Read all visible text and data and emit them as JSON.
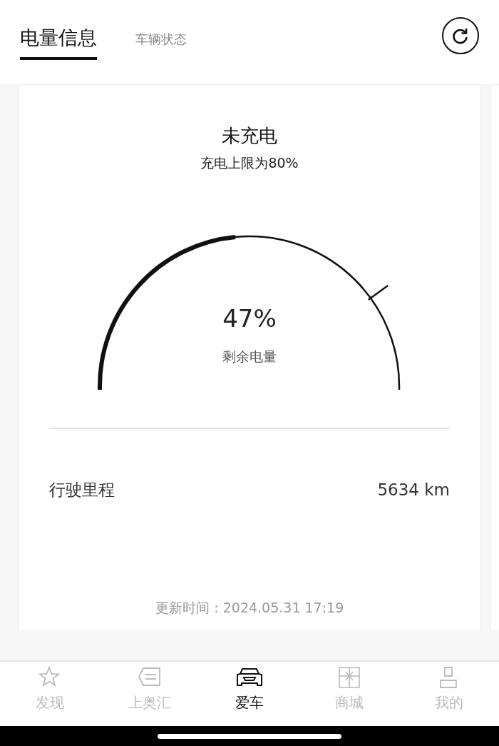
{
  "tabs": [
    {
      "label": "电量信息",
      "selected": true
    },
    {
      "label": "车辆状态",
      "selected": false
    }
  ],
  "battery_card": {
    "status": "未充电",
    "charge_limit_text": "充电上限为80%",
    "percent": "47%",
    "percent_label": "剩余电量",
    "mileage": {
      "label": "行驶里程",
      "value": "5634 km"
    },
    "updated": "更新时间：2024.05.31 17:19"
  },
  "bottom_nav": [
    {
      "label": "发现",
      "kind": "star",
      "selected": false
    },
    {
      "label": "上奥汇",
      "kind": "tag",
      "selected": false
    },
    {
      "label": "爱车",
      "kind": "car",
      "selected": true
    },
    {
      "label": "商城",
      "kind": "gift",
      "selected": false
    },
    {
      "label": "我的",
      "kind": "person",
      "selected": false
    }
  ]
}
